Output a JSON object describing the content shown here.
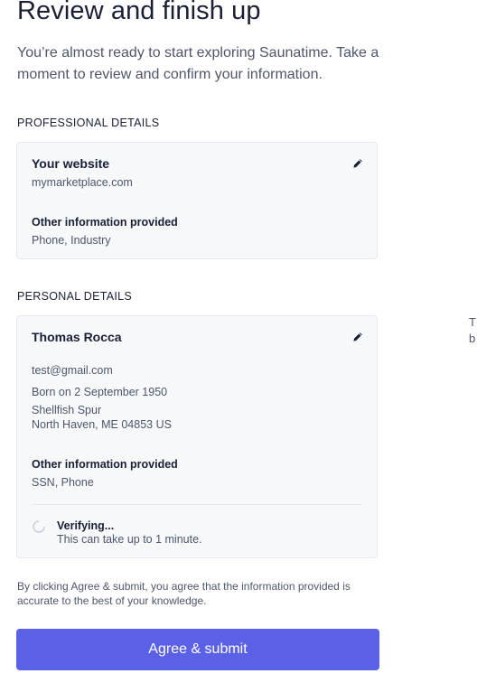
{
  "header": {
    "title": "Review and finish up",
    "intro": "You’re almost ready to start exploring Saunatime. Take a moment to review and confirm your information."
  },
  "professional": {
    "heading": "PROFESSIONAL DETAILS",
    "website_label": "Your website",
    "website_value": "mymarketplace.com",
    "other_label": "Other information provided",
    "other_value": "Phone, Industry",
    "edit_icon": "pencil-icon"
  },
  "personal": {
    "heading": "PERSONAL DETAILS",
    "name": "Thomas Rocca",
    "email": "test@gmail.com",
    "born": "Born on 2 September 1950",
    "address_line1": "Shellfish Spur",
    "address_line2": "North Haven, ME 04853 US",
    "other_label": "Other information provided",
    "other_value": "SSN, Phone",
    "edit_icon": "pencil-icon",
    "status": {
      "icon": "spinner-icon",
      "title": "Verifying...",
      "subtitle": "This can take up to 1 minute."
    }
  },
  "consent_text": "By clicking Agree & submit, you agree that the information provided is accurate to the best of your knowledge.",
  "submit_label": "Agree & submit",
  "side_panel": {
    "line1": "T",
    "line2": "b"
  },
  "colors": {
    "accent": "#5b61e6",
    "card_bg": "#f6f8fa",
    "border": "#e3e8ee",
    "text_primary": "#1a1f36",
    "text_secondary": "#4f566b"
  }
}
